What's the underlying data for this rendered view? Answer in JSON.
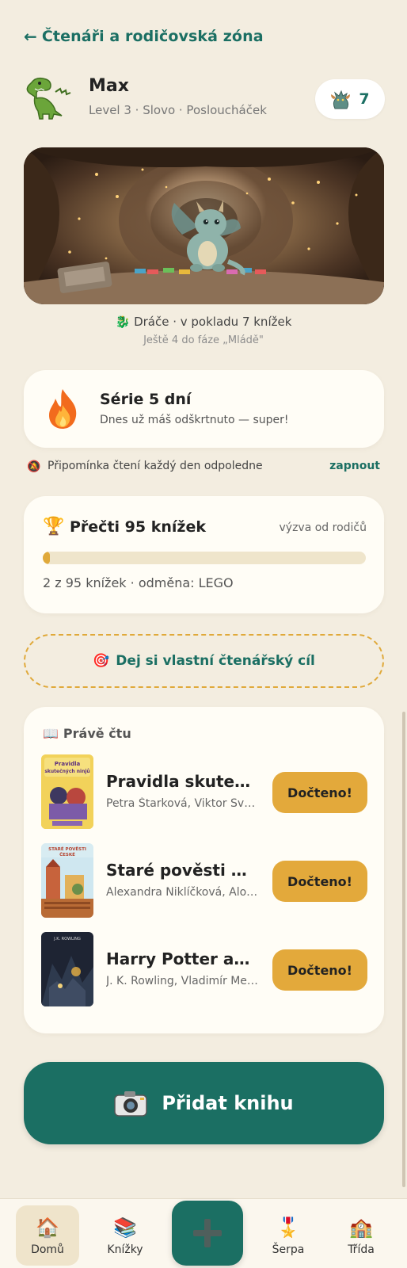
{
  "header": {
    "back_label": "Čtenáři a rodičovská zóna"
  },
  "profile": {
    "name": "Max",
    "subtitle": "Level 3 · Slovo · Posloucháček",
    "egg_count": "7"
  },
  "dragon": {
    "status": "Dráče · v pokladu 7 knížek",
    "next_stage": "Ještě 4 do fáze „Mládě\""
  },
  "streak": {
    "title": "Série 5 dní",
    "subtitle": "Dnes už máš odškrtnuto — super!"
  },
  "reminder": {
    "text": "Připomínka čtení každý den odpoledne",
    "action": "zapnout"
  },
  "goal": {
    "title": "Přečti 95 knížek",
    "tag": "výzva od rodičů",
    "progress": 0.021,
    "summary": "2 z 95 knížek · odměna: LEGO"
  },
  "own_goal": {
    "label": "Dej si vlastní čtenářský cíl"
  },
  "reading": {
    "heading": "Právě čtu",
    "done_label": "Dočteno!",
    "books": [
      {
        "title": "Pravidla skutečných ninjů",
        "author": "Petra Štarková, Viktor Svoboda",
        "cover_text": "Pravidla skutečných ninjů"
      },
      {
        "title": "Staré pověsti české",
        "author": "Alexandra Niklíčková, Alois Jirásek",
        "cover_text": "STARÉ POVĚSTI ČESKÉ"
      },
      {
        "title": "Harry Potter a Kámen mudrců",
        "author": "J. K. Rowling, Vladimír Medek",
        "cover_text": "J.K. ROWLING"
      }
    ]
  },
  "add_book": {
    "label": "Přidat knihu"
  },
  "nav": {
    "home": "Domů",
    "books": "Knížky",
    "sash": "Šerpa",
    "class": "Třída"
  },
  "colors": {
    "accent": "#1B6F63",
    "gold": "#E3A93B",
    "background": "#F3EDE0",
    "card": "#FFFDF6"
  }
}
